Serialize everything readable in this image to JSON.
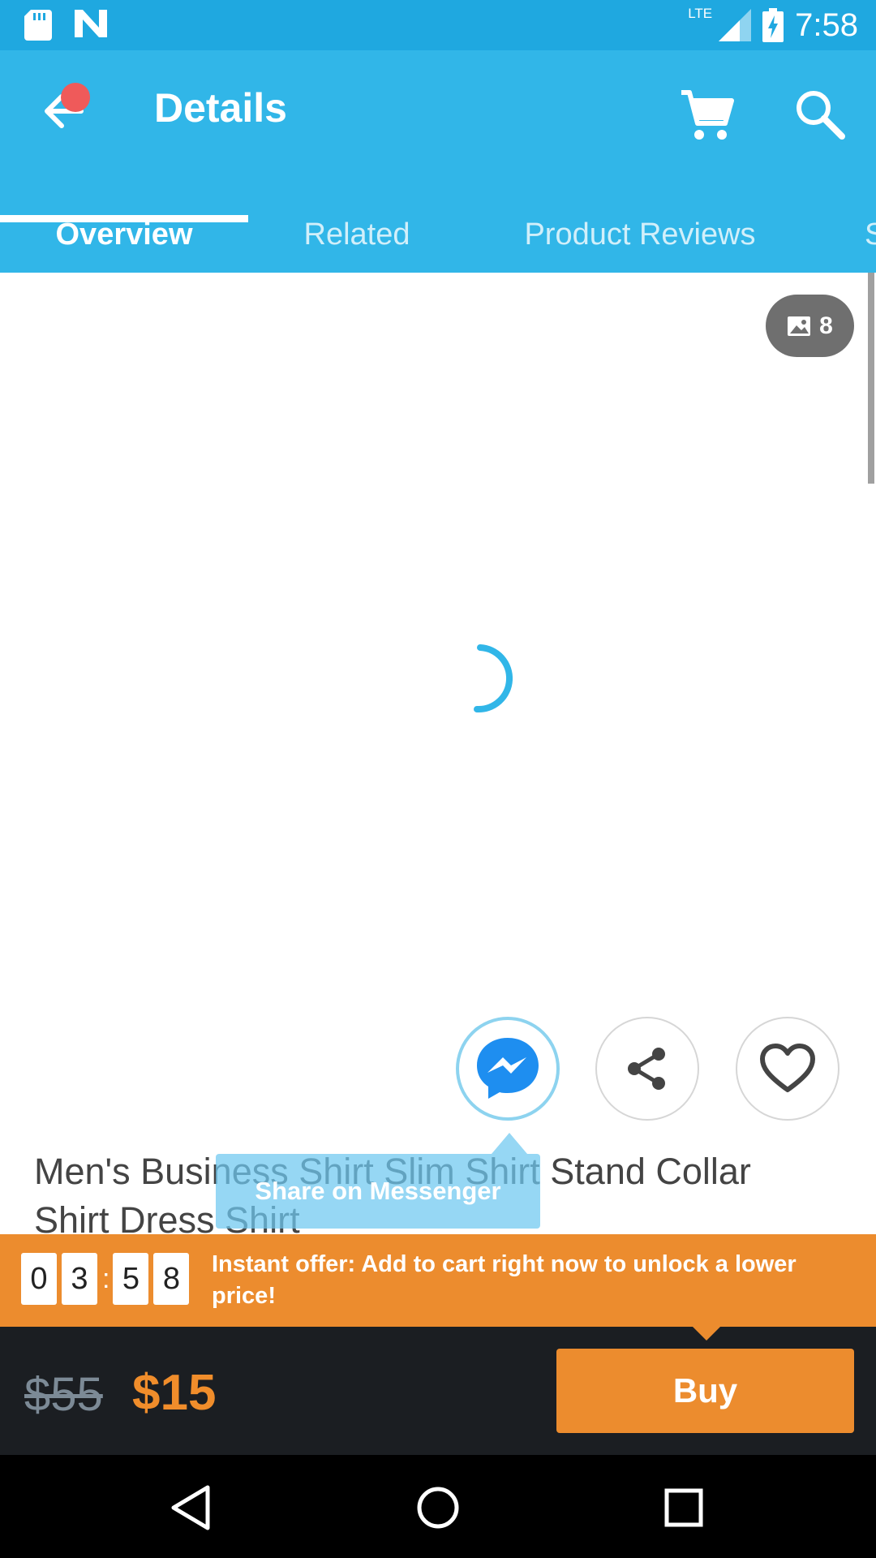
{
  "status_bar": {
    "network_label": "LTE",
    "time": "7:58",
    "icons": [
      "sd-card-icon",
      "n-notification-icon",
      "signal-icon",
      "battery-charging-icon"
    ]
  },
  "header": {
    "title": "Details",
    "back_icon": "back-arrow-icon",
    "cart_icon": "cart-icon",
    "search_icon": "search-icon",
    "notification_dot_color": "#ef5a5a"
  },
  "tabs": [
    {
      "label": "Overview",
      "active": true
    },
    {
      "label": "Related",
      "active": false
    },
    {
      "label": "Product Reviews",
      "active": false
    },
    {
      "label": "S",
      "active": false
    }
  ],
  "gallery": {
    "image_count": "8"
  },
  "actions": {
    "tooltip": "Share on Messenger"
  },
  "product": {
    "title": "Men's Business Shirt Slim Shirt Stand Collar Shirt Dress Shirt"
  },
  "offer": {
    "timer_digits": [
      "0",
      "3",
      "5",
      "8"
    ],
    "timer_separator": ":",
    "text": "Instant offer: Add to cart right now to unlock a lower price!"
  },
  "purchase": {
    "old_price": "$55",
    "new_price": "$15",
    "buy_label": "Buy"
  },
  "colors": {
    "status_bar": "#1fa8e0",
    "app_bar": "#31b6e8",
    "accent_orange": "#ec8c2e",
    "bottom_bar": "#1b1e22"
  }
}
